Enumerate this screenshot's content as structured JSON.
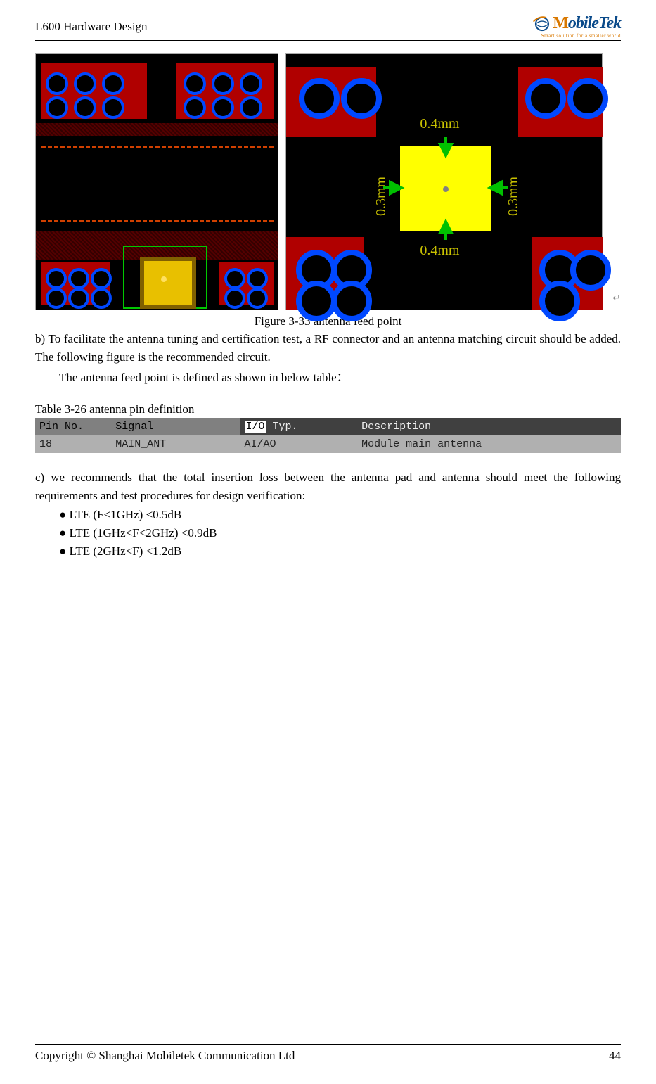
{
  "header": {
    "doc_title": "L600 Hardware Design",
    "logo": {
      "name_prefix": "M",
      "name_rest": "obileTek",
      "tagline": "Smart solution for a smaller world"
    }
  },
  "figure": {
    "caption": "Figure 3-33 antenna feed point",
    "right_labels": {
      "top": "0.4mm",
      "left": "0.3mm",
      "right": "0.3mm",
      "bottom": "0.4mm"
    }
  },
  "para_b": "b) To facilitate the antenna tuning and certification test, a RF connector and an antenna matching circuit should be added. The following figure is the recommended circuit.",
  "para_b2": "The antenna feed point is defined as shown in below table：",
  "table": {
    "caption": "Table 3-26 antenna pin definition",
    "headers": {
      "pin": "Pin No.",
      "signal": "Signal",
      "io_label_prefix": "I/O",
      "io_label_suffix": " Typ.",
      "desc": "Description"
    },
    "row": {
      "pin": "18",
      "signal": "MAIN_ANT",
      "io": "AI/AO",
      "desc": "Module main antenna"
    }
  },
  "para_c": "c) we recommends that the total insertion loss between the antenna pad and antenna should meet the following requirements and test procedures for design verification:",
  "bullets": [
    "● LTE (F<1GHz) <0.5dB",
    "● LTE (1GHz<F<2GHz) <0.9dB",
    "● LTE (2GHz<F) <1.2dB"
  ],
  "footer": {
    "copyright": "Copyright  ©  Shanghai  Mobiletek  Communication  Ltd",
    "page": "44"
  }
}
